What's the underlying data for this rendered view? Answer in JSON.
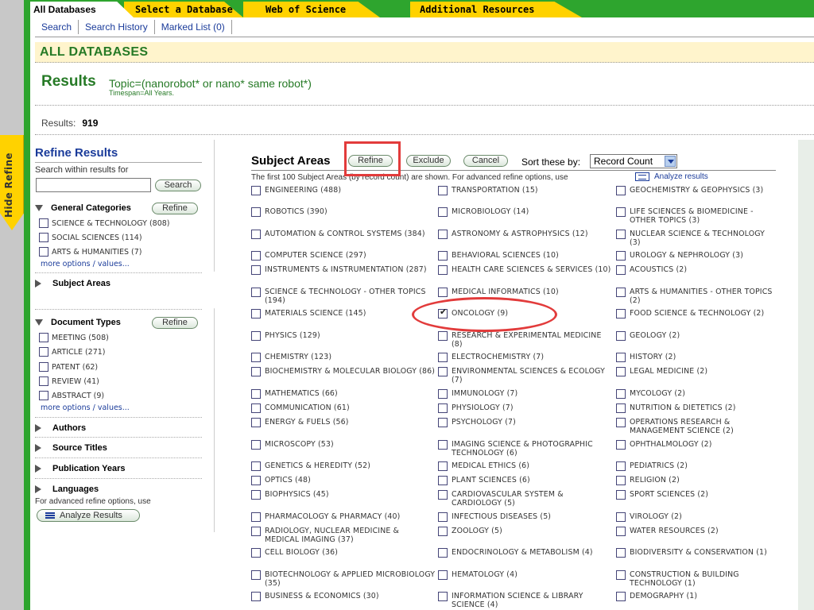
{
  "sidebar_toggle": {
    "label": "Hide Refine"
  },
  "tabs": [
    {
      "label": "All Databases"
    },
    {
      "label": "Select a Database"
    },
    {
      "label": "Web of Science"
    },
    {
      "label": "Additional Resources"
    }
  ],
  "subnav": [
    {
      "label": "Search"
    },
    {
      "label": "Search History"
    },
    {
      "label": "Marked List (0)"
    }
  ],
  "page_title": "ALL DATABASES",
  "results": {
    "heading": "Results",
    "query": "Topic=(nanorobot* or nano* same robot*)",
    "timespan": "Timespan=All Years.",
    "count_label": "Results:",
    "count": "919"
  },
  "refine": {
    "title": "Refine Results",
    "search_within_label": "Search within results for",
    "search_within_value": "",
    "search_button": "Search",
    "refine_button": "Refine",
    "general_categories": {
      "title": "General Categories",
      "items": [
        "SCIENCE & TECHNOLOGY (808)",
        "SOCIAL SCIENCES (114)",
        "ARTS & HUMANITIES (7)"
      ],
      "more": "more options / values..."
    },
    "subject_areas_title": "Subject Areas",
    "document_types": {
      "title": "Document Types",
      "items": [
        "MEETING (508)",
        "ARTICLE (271)",
        "PATENT (62)",
        "REVIEW (41)",
        "ABSTRACT (9)"
      ],
      "more": "more options / values..."
    },
    "collapsed_sections": [
      "Authors",
      "Source Titles",
      "Publication Years",
      "Languages"
    ],
    "analyze_label": "For advanced refine options, use",
    "analyze_button": "Analyze Results"
  },
  "subject_areas": {
    "title": "Subject Areas",
    "refine_button": "Refine",
    "exclude_button": "Exclude",
    "cancel_button": "Cancel",
    "sort_label": "Sort these by:",
    "sort_value": "Record Count",
    "note": "The first 100 Subject Areas (by record count) are shown. For advanced refine options, use",
    "analyze_link": "Analyze results",
    "columns": [
      [
        "ENGINEERING (488)",
        "ROBOTICS (390)",
        "AUTOMATION & CONTROL SYSTEMS (384)",
        "COMPUTER SCIENCE (297)",
        "INSTRUMENTS & INSTRUMENTATION (287)",
        "SCIENCE & TECHNOLOGY - OTHER TOPICS (194)",
        "MATERIALS SCIENCE (145)",
        "PHYSICS (129)",
        "CHEMISTRY (123)",
        "BIOCHEMISTRY & MOLECULAR BIOLOGY (86)",
        "MATHEMATICS (66)",
        "COMMUNICATION (61)",
        "ENERGY & FUELS (56)",
        "MICROSCOPY (53)",
        "GENETICS & HEREDITY (52)",
        "OPTICS (48)",
        "BIOPHYSICS (45)",
        "PHARMACOLOGY & PHARMACY (40)",
        "RADIOLOGY, NUCLEAR MEDICINE & MEDICAL IMAGING (37)",
        "CELL BIOLOGY (36)",
        "BIOTECHNOLOGY & APPLIED MICROBIOLOGY (35)",
        "BUSINESS & ECONOMICS (30)"
      ],
      [
        "TRANSPORTATION (15)",
        "MICROBIOLOGY (14)",
        "ASTRONOMY & ASTROPHYSICS (12)",
        "BEHAVIORAL SCIENCES (10)",
        "HEALTH CARE SCIENCES & SERVICES (10)",
        "MEDICAL INFORMATICS (10)",
        "ONCOLOGY (9)",
        "RESEARCH & EXPERIMENTAL MEDICINE (8)",
        "ELECTROCHEMISTRY (7)",
        "ENVIRONMENTAL SCIENCES & ECOLOGY (7)",
        "IMMUNOLOGY (7)",
        "PHYSIOLOGY (7)",
        "PSYCHOLOGY (7)",
        "IMAGING SCIENCE & PHOTOGRAPHIC TECHNOLOGY (6)",
        "MEDICAL ETHICS (6)",
        "PLANT SCIENCES (6)",
        "CARDIOVASCULAR SYSTEM & CARDIOLOGY (5)",
        "INFECTIOUS DISEASES (5)",
        "ZOOLOGY (5)",
        "ENDOCRINOLOGY & METABOLISM (4)",
        "HEMATOLOGY (4)",
        "INFORMATION SCIENCE & LIBRARY SCIENCE (4)"
      ],
      [
        "GEOCHEMISTRY & GEOPHYSICS (3)",
        "LIFE SCIENCES & BIOMEDICINE - OTHER TOPICS (3)",
        "NUCLEAR SCIENCE & TECHNOLOGY (3)",
        "UROLOGY & NEPHROLOGY (3)",
        "ACOUSTICS (2)",
        "ARTS & HUMANITIES - OTHER TOPICS (2)",
        "FOOD SCIENCE & TECHNOLOGY (2)",
        "GEOLOGY (2)",
        "HISTORY (2)",
        "LEGAL MEDICINE (2)",
        "MYCOLOGY (2)",
        "NUTRITION & DIETETICS (2)",
        "OPERATIONS RESEARCH & MANAGEMENT SCIENCE (2)",
        "OPHTHALMOLOGY (2)",
        "PEDIATRICS (2)",
        "RELIGION (2)",
        "SPORT SCIENCES (2)",
        "VIROLOGY (2)",
        "WATER RESOURCES (2)",
        "BIODIVERSITY & CONSERVATION (1)",
        "CONSTRUCTION & BUILDING TECHNOLOGY (1)",
        "DEMOGRAPHY (1)"
      ]
    ],
    "checked": [
      "ONCOLOGY (9)"
    ]
  }
}
